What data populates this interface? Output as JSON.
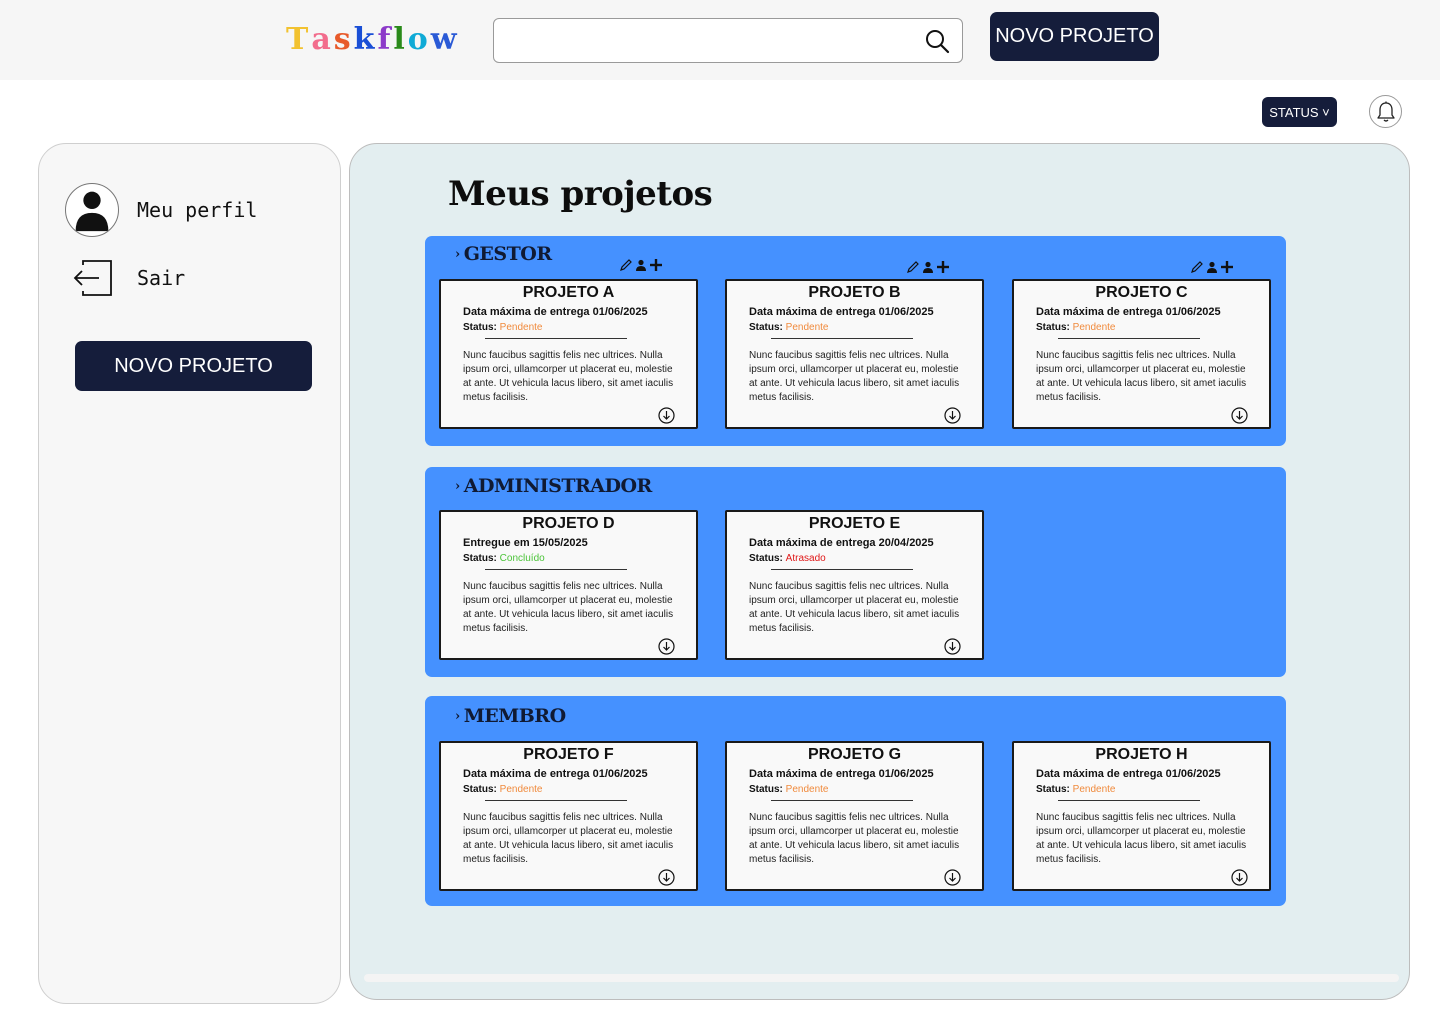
{
  "header": {
    "logo_letters": [
      "T",
      "a",
      "s",
      "k",
      "f",
      "l",
      "o",
      "w"
    ],
    "logo_colors": [
      "#f2c230",
      "#f26c8c",
      "#e85a2a",
      "#1a4fd6",
      "#8c3ac9",
      "#2a8a1a",
      "#0faad6",
      "#2a5ad6"
    ],
    "search_placeholder": "",
    "new_project_label": "NOVO PROJETO",
    "status_filter_label": "STATUS ˅"
  },
  "sidebar": {
    "profile_label": "Meu perfil",
    "logout_label": "Sair",
    "new_project_label": "NOVO PROJETO"
  },
  "main": {
    "title": "Meus projetos",
    "sections": [
      {
        "title": "GESTOR",
        "cards": [
          {
            "title": "PROJETO A",
            "date": "Data máxima de entrega 01/06/2025",
            "status_label": "Status: ",
            "status": "Pendente",
            "status_color": "#f08a3c",
            "desc": "Nunc faucibus sagittis felis nec ultrices. Nulla ipsum orci, ullamcorper ut placerat eu, molestie at ante. Ut vehicula lacus libero, sit amet iaculis metus facilisis."
          },
          {
            "title": "PROJETO B",
            "date": "Data máxima de entrega 01/06/2025",
            "status_label": "Status: ",
            "status": "Pendente",
            "status_color": "#f08a3c",
            "desc": "Nunc faucibus sagittis felis nec ultrices. Nulla ipsum orci, ullamcorper ut placerat eu, molestie at ante. Ut vehicula lacus libero, sit amet iaculis metus facilisis."
          },
          {
            "title": "PROJETO C",
            "date": "Data máxima de entrega 01/06/2025",
            "status_label": "Status: ",
            "status": "Pendente",
            "status_color": "#f08a3c",
            "desc": "Nunc faucibus sagittis felis nec ultrices. Nulla ipsum orci, ullamcorper ut placerat eu, molestie at ante. Ut vehicula lacus libero, sit amet iaculis metus facilisis."
          }
        ]
      },
      {
        "title": "ADMINISTRADOR",
        "cards": [
          {
            "title": "PROJETO D",
            "date": "Entregue em 15/05/2025",
            "status_label": "Status: ",
            "status": "Concluído",
            "status_color": "#4cc43a",
            "desc": "Nunc faucibus sagittis felis nec ultrices. Nulla ipsum orci, ullamcorper ut placerat eu, molestie at ante. Ut vehicula lacus libero, sit amet iaculis metus facilisis."
          },
          {
            "title": "PROJETO E",
            "date": "Data máxima de entrega  20/04/2025",
            "status_label": "Status: ",
            "status": "Atrasado",
            "status_color": "#e01818",
            "desc": "Nunc faucibus sagittis felis nec ultrices. Nulla ipsum orci, ullamcorper ut placerat eu, molestie at ante. Ut vehicula lacus libero, sit amet iaculis metus facilisis."
          }
        ]
      },
      {
        "title": "MEMBRO",
        "cards": [
          {
            "title": "PROJETO F",
            "date": "Data máxima de entrega 01/06/2025",
            "status_label": "Status: ",
            "status": "Pendente",
            "status_color": "#f08a3c",
            "desc": "Nunc faucibus sagittis felis nec ultrices. Nulla ipsum orci, ullamcorper ut placerat eu, molestie at ante. Ut vehicula lacus libero, sit amet iaculis metus facilisis."
          },
          {
            "title": "PROJETO G",
            "date": "Data máxima de entrega 01/06/2025",
            "status_label": "Status: ",
            "status": "Pendente",
            "status_color": "#f08a3c",
            "desc": "Nunc faucibus sagittis felis nec ultrices. Nulla ipsum orci, ullamcorper ut placerat eu, molestie at ante. Ut vehicula lacus libero, sit amet iaculis metus facilisis."
          },
          {
            "title": "PROJETO H",
            "date": "Data máxima de entrega 01/06/2025",
            "status_label": "Status: ",
            "status": "Pendente",
            "status_color": "#f08a3c",
            "desc": "Nunc faucibus sagittis felis nec ultrices. Nulla ipsum orci, ullamcorper ut placerat eu, molestie at ante. Ut vehicula lacus libero, sit amet iaculis metus facilisis."
          }
        ]
      }
    ]
  },
  "colors": {
    "primary_dark": "#151d3b",
    "section_blue": "#4591ff",
    "panel_bg": "#e3eef0"
  }
}
